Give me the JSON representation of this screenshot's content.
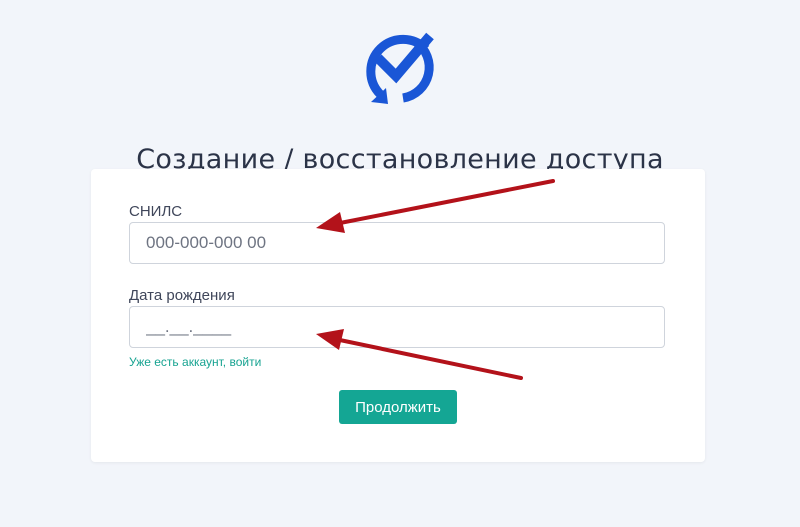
{
  "header": {
    "title": "Создание / восстановление доступа",
    "logo_icon": "refresh-check-logo-icon"
  },
  "form": {
    "snils": {
      "label": "СНИЛС",
      "placeholder": "000-000-000 00",
      "value": ""
    },
    "birth_date": {
      "label": "Дата рождения",
      "placeholder": "__.__.____",
      "value": ""
    },
    "login_link": "Уже есть аккаунт, войти",
    "continue_label": "Продолжить"
  },
  "colors": {
    "background": "#f2f5fa",
    "accent": "#14a694",
    "link": "#17a391",
    "logo_blue": "#1a56d6",
    "annotation_arrow": "#b3121a"
  }
}
